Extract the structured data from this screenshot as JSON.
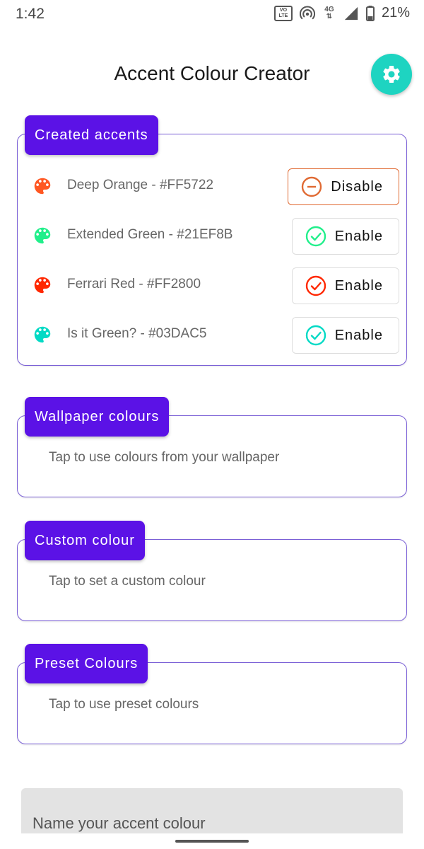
{
  "status_bar": {
    "time": "1:42",
    "volte_top": "VO",
    "volte_bottom": "LTE",
    "network": "4G",
    "battery": "21%"
  },
  "header": {
    "title": "Accent Colour Creator",
    "settings_icon": "gear-icon"
  },
  "created_accents": {
    "label": "Created accents",
    "items": [
      {
        "label": "Deep Orange - #FF5722",
        "color": "#FF5722",
        "button": "Disable",
        "status_icon": "minus-circle-icon"
      },
      {
        "label": "Extended Green - #21EF8B",
        "color": "#21EF8B",
        "button": "Enable",
        "status_icon": "check-circle-icon"
      },
      {
        "label": "Ferrari Red - #FF2800",
        "color": "#FF2800",
        "button": "Enable",
        "status_icon": "check-circle-icon"
      },
      {
        "label": "Is it Green? - #03DAC5",
        "color": "#03DAC5",
        "button": "Enable",
        "status_icon": "check-circle-icon"
      }
    ]
  },
  "wallpaper": {
    "label": "Wallpaper colours",
    "description": "Tap to use colours from your wallpaper"
  },
  "custom": {
    "label": "Custom colour",
    "description": "Tap to set a custom colour"
  },
  "preset": {
    "label": "Preset Colours",
    "description": "Tap to use preset colours"
  },
  "name_input": {
    "placeholder": "Name your accent colour",
    "value": ""
  },
  "colors": {
    "accent_purple": "#5B12E6",
    "fab_teal": "#1ED4C1",
    "card_border": "#7A5FD6"
  }
}
